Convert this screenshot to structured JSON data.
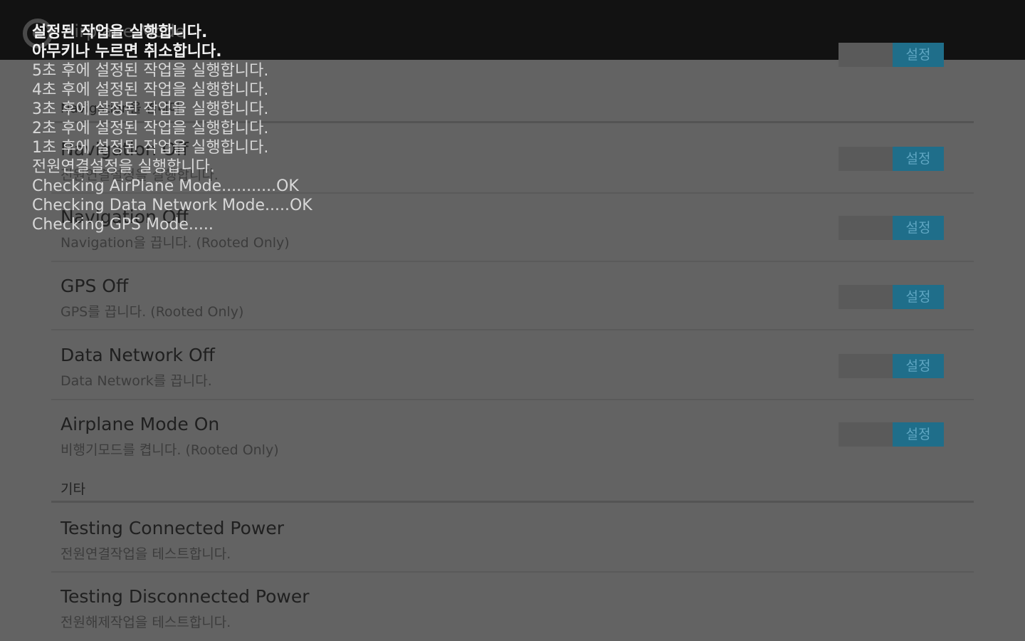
{
  "app": {
    "title": "Airplane Mode"
  },
  "partial_rows": {
    "top_sub": "Navigation을 켭니다",
    "row1_sub": "전원연결설정을 실행합니다.",
    "row2_title": "Navigation Off"
  },
  "settings": [
    {
      "title": "Navigation Off",
      "subtitle": "Navigation을 끕니다. (Rooted Only)",
      "toggle_label": "설정"
    },
    {
      "title": "GPS Off",
      "subtitle": "GPS를 끕니다. (Rooted Only)",
      "toggle_label": "설정"
    },
    {
      "title": "Data Network Off",
      "subtitle": "Data Network를 끕니다.",
      "toggle_label": "설정"
    },
    {
      "title": "Airplane Mode On",
      "subtitle": "비행기모드를 켭니다. (Rooted Only)",
      "toggle_label": "설정"
    }
  ],
  "toggle_extra": {
    "label": "설정"
  },
  "section_other": {
    "label": "기타"
  },
  "other_items": [
    {
      "title": "Testing Connected Power",
      "subtitle": "전원연결작업을 테스트합니다."
    },
    {
      "title": "Testing Disconnected Power",
      "subtitle": "전원해제작업을 테스트합니다."
    }
  ],
  "log_lines": [
    "설정된 작업을 실행합니다.",
    "아무키나 누르면 취소합니다.",
    "5초 후에 설정된 작업을 실행합니다.",
    "4초 후에 설정된 작업을 실행합니다.",
    "3초 후에 설정된 작업을 실행합니다.",
    "2초 후에 설정된 작업을 실행합니다.",
    "1초 후에 설정된 작업을 실행합니다.",
    "전원연결설정을 실행합니다.",
    "Checking AirPlane Mode...........OK",
    "Checking Data Network Mode.....OK",
    "Checking GPS Mode....."
  ],
  "colors": {
    "toggle_on": "#1f6e8a",
    "background": "#636363",
    "topbar": "#121212"
  }
}
